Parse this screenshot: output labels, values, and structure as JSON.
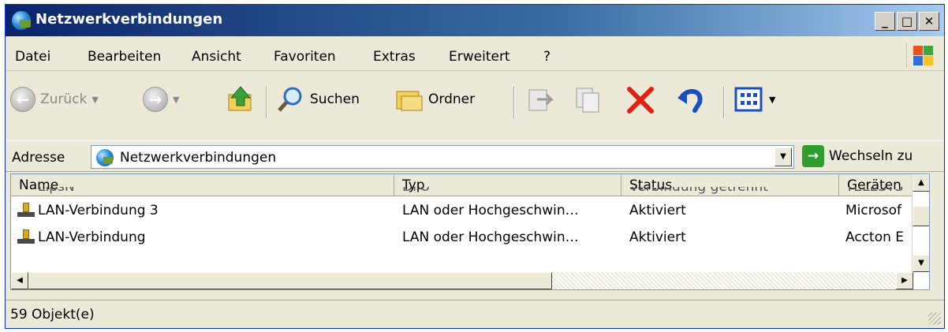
{
  "window": {
    "title": "Netzwerkverbindungen",
    "title_icon": "network-connections-icon"
  },
  "titlebar_buttons": {
    "minimize": "_",
    "maximize": "□",
    "close": "✕"
  },
  "menu": [
    "Datei",
    "Bearbeiten",
    "Ansicht",
    "Favoriten",
    "Extras",
    "Erweitert",
    "?"
  ],
  "toolbar": {
    "back_label": "Zurück",
    "search_label": "Suchen",
    "folders_label": "Ordner"
  },
  "address": {
    "label": "Adresse",
    "value": "Netzwerkverbindungen",
    "go_label": "Wechseln zu"
  },
  "list": {
    "columns": [
      "Name",
      "Typ",
      "Status",
      "Geräten"
    ],
    "partial_row": [
      "LipsN",
      "DFÜ",
      "Verbindung getrennt",
      "TELESYS"
    ],
    "rows": [
      {
        "name": "LAN-Verbindung 3",
        "type": "LAN oder Hochgeschwin…",
        "status": "Aktiviert",
        "device": "Microsof"
      },
      {
        "name": "LAN-Verbindung",
        "type": "LAN oder Hochgeschwin…",
        "status": "Aktiviert",
        "device": "Accton E"
      }
    ]
  },
  "status": {
    "text": "59 Objekt(e)"
  },
  "colors": {
    "titlebar": "#0a246a",
    "chrome": "#ece9d8",
    "delete_red": "#e02010",
    "undo_blue": "#1a4fc0",
    "go_green": "#2f9e2f"
  }
}
